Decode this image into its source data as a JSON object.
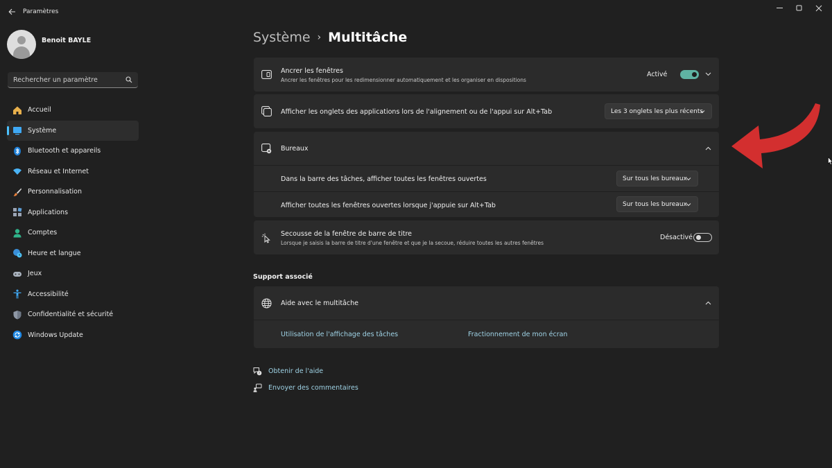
{
  "window": {
    "app_title": "Paramètres",
    "back_icon": "back-arrow-icon",
    "controls": [
      "minimize-icon",
      "maximize-icon",
      "close-icon"
    ]
  },
  "profile": {
    "name": "Benoit BAYLE"
  },
  "search": {
    "placeholder": "Rechercher un paramètre",
    "icon": "search-icon"
  },
  "sidebar": {
    "items": [
      {
        "label": "Accueil",
        "icon": "home-icon",
        "active": false
      },
      {
        "label": "Système",
        "icon": "system-icon",
        "active": true
      },
      {
        "label": "Bluetooth et appareils",
        "icon": "bluetooth-icon",
        "active": false
      },
      {
        "label": "Réseau et Internet",
        "icon": "wifi-icon",
        "active": false
      },
      {
        "label": "Personnalisation",
        "icon": "brush-icon",
        "active": false
      },
      {
        "label": "Applications",
        "icon": "apps-icon",
        "active": false
      },
      {
        "label": "Comptes",
        "icon": "account-icon",
        "active": false
      },
      {
        "label": "Heure et langue",
        "icon": "globe-clock-icon",
        "active": false
      },
      {
        "label": "Jeux",
        "icon": "gamepad-icon",
        "active": false
      },
      {
        "label": "Accessibilité",
        "icon": "accessibility-icon",
        "active": false
      },
      {
        "label": "Confidentialité et sécurité",
        "icon": "shield-icon",
        "active": false
      },
      {
        "label": "Windows Update",
        "icon": "update-icon",
        "active": false
      }
    ],
    "accent_color": "#4cc2ff"
  },
  "breadcrumb": {
    "parent": "Système",
    "separator": "›",
    "current": "Multitâche"
  },
  "settings": {
    "snap": {
      "title": "Ancrer les fenêtres",
      "subtitle": "Ancrer les fenêtres pour les redimensionner automatiquement et les organiser en dispositions",
      "state": "Activé",
      "toggle_on": true
    },
    "tabs": {
      "title": "Afficher les onglets des applications lors de l'alignement ou de l'appui sur Alt+Tab",
      "value": "Les 3 onglets les plus récents"
    },
    "desktops": {
      "title": "Bureaux",
      "taskbar_label": "Dans la barre des tâches, afficher toutes les fenêtres ouvertes",
      "taskbar_value": "Sur tous les bureaux",
      "alttab_label": "Afficher toutes les fenêtres ouvertes lorsque j'appuie sur Alt+Tab",
      "alttab_value": "Sur tous les bureaux"
    },
    "shake": {
      "title": "Secousse de la fenêtre de barre de titre",
      "subtitle": "Lorsque je saisis la barre de titre d'une fenêtre et que je la secoue, réduire toutes les autres fenêtres",
      "state": "Désactivé",
      "toggle_on": false
    }
  },
  "support": {
    "section_title": "Support associé",
    "card_title": "Aide avec le multitâche",
    "links": [
      "Utilisation de l'affichage des tâches",
      "Fractionnement de mon écran"
    ]
  },
  "footer": {
    "help": "Obtenir de l'aide",
    "feedback": "Envoyer des commentaires"
  },
  "colors": {
    "background": "#202020",
    "card": "#2b2b2b",
    "toggle_on": "#5fb3a3",
    "link": "#9fd3e6",
    "annotation_arrow": "#d32f2f"
  }
}
